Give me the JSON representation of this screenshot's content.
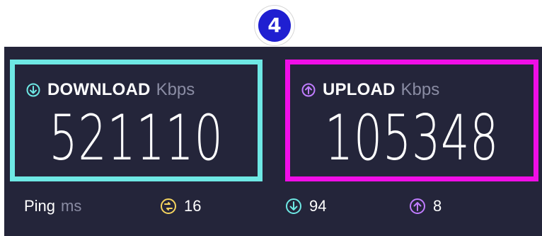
{
  "step_badge": {
    "text": "4",
    "color": "#1f1fd1"
  },
  "download": {
    "label": "DOWNLOAD",
    "unit": "Kbps",
    "value": "521110",
    "icon": "download-arrow-icon",
    "highlight_color": "#6ee8e4"
  },
  "upload": {
    "label": "UPLOAD",
    "unit": "Kbps",
    "value": "105348",
    "icon": "upload-arrow-icon",
    "highlight_color": "#f00ee6"
  },
  "ping": {
    "label": "Ping",
    "unit": "ms",
    "jitter_value": "16",
    "download_latency": "94",
    "upload_latency": "8",
    "jitter_icon": "jitter-icon",
    "download_icon": "download-arrow-icon",
    "upload_icon": "upload-arrow-icon",
    "jitter_color": "#f4d35e",
    "download_color": "#6ee8e4",
    "upload_color": "#c07cff"
  },
  "colors": {
    "panel": "#24253a",
    "muted_text": "#8a8ca3"
  }
}
